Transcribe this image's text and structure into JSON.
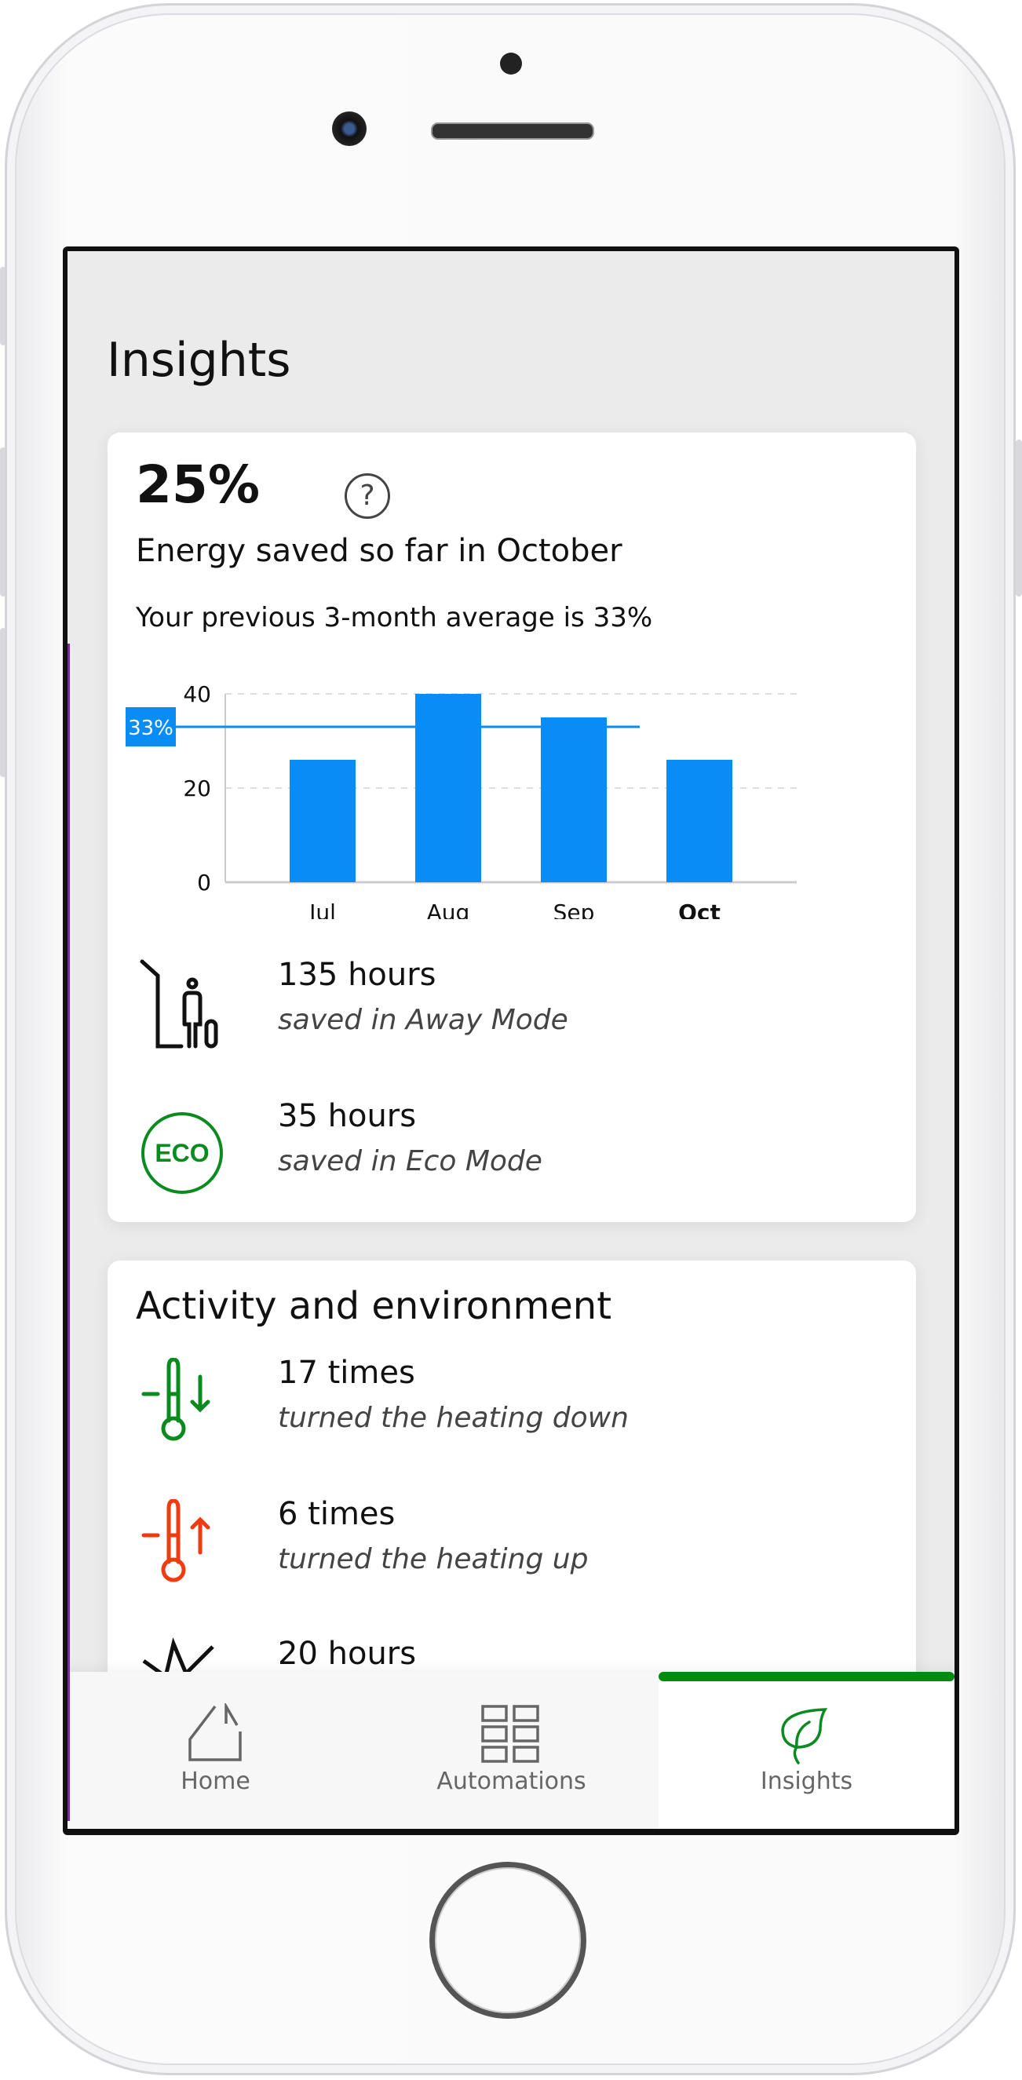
{
  "header": {
    "title": "Insights"
  },
  "savings_card": {
    "percent": "25%",
    "help_icon": "question-circle-icon",
    "headline": "Energy saved so far in October",
    "average_text": "Your previous 3-month average is 33%",
    "rows": [
      {
        "icon": "away-mode-icon",
        "value": "135 hours",
        "label": "saved in Away Mode"
      },
      {
        "icon": "eco-icon",
        "icon_text": "ECO",
        "value": "35 hours",
        "label": "saved in Eco Mode"
      }
    ]
  },
  "chart_data": {
    "type": "bar",
    "categories": [
      "Jul",
      "Aug",
      "Sep",
      "Oct"
    ],
    "values": [
      26,
      40,
      35,
      26
    ],
    "highlighted_category": "Oct",
    "yticks": [
      "0",
      "20",
      "40"
    ],
    "ylim": [
      0,
      40
    ],
    "grid": true,
    "reference_line": {
      "value": 33,
      "label": "33%"
    },
    "bar_color": "#0a8cf7"
  },
  "activity_card": {
    "title": "Activity and environment",
    "rows": [
      {
        "icon": "thermometer-down-icon",
        "value": "17 times",
        "label": "turned the heating down",
        "color": "#0a8a1f"
      },
      {
        "icon": "thermometer-up-icon",
        "value": "6 times",
        "label": "turned the heating up",
        "color": "#f03a10"
      },
      {
        "icon": "sun-icon",
        "value": "20 hours",
        "label": ""
      }
    ]
  },
  "tabbar": {
    "active": "Insights",
    "accent": "#008a0e",
    "tabs": [
      {
        "label": "Home",
        "icon": "home-icon"
      },
      {
        "label": "Automations",
        "icon": "grid-icon"
      },
      {
        "label": "Insights",
        "icon": "leaf-icon"
      }
    ]
  }
}
